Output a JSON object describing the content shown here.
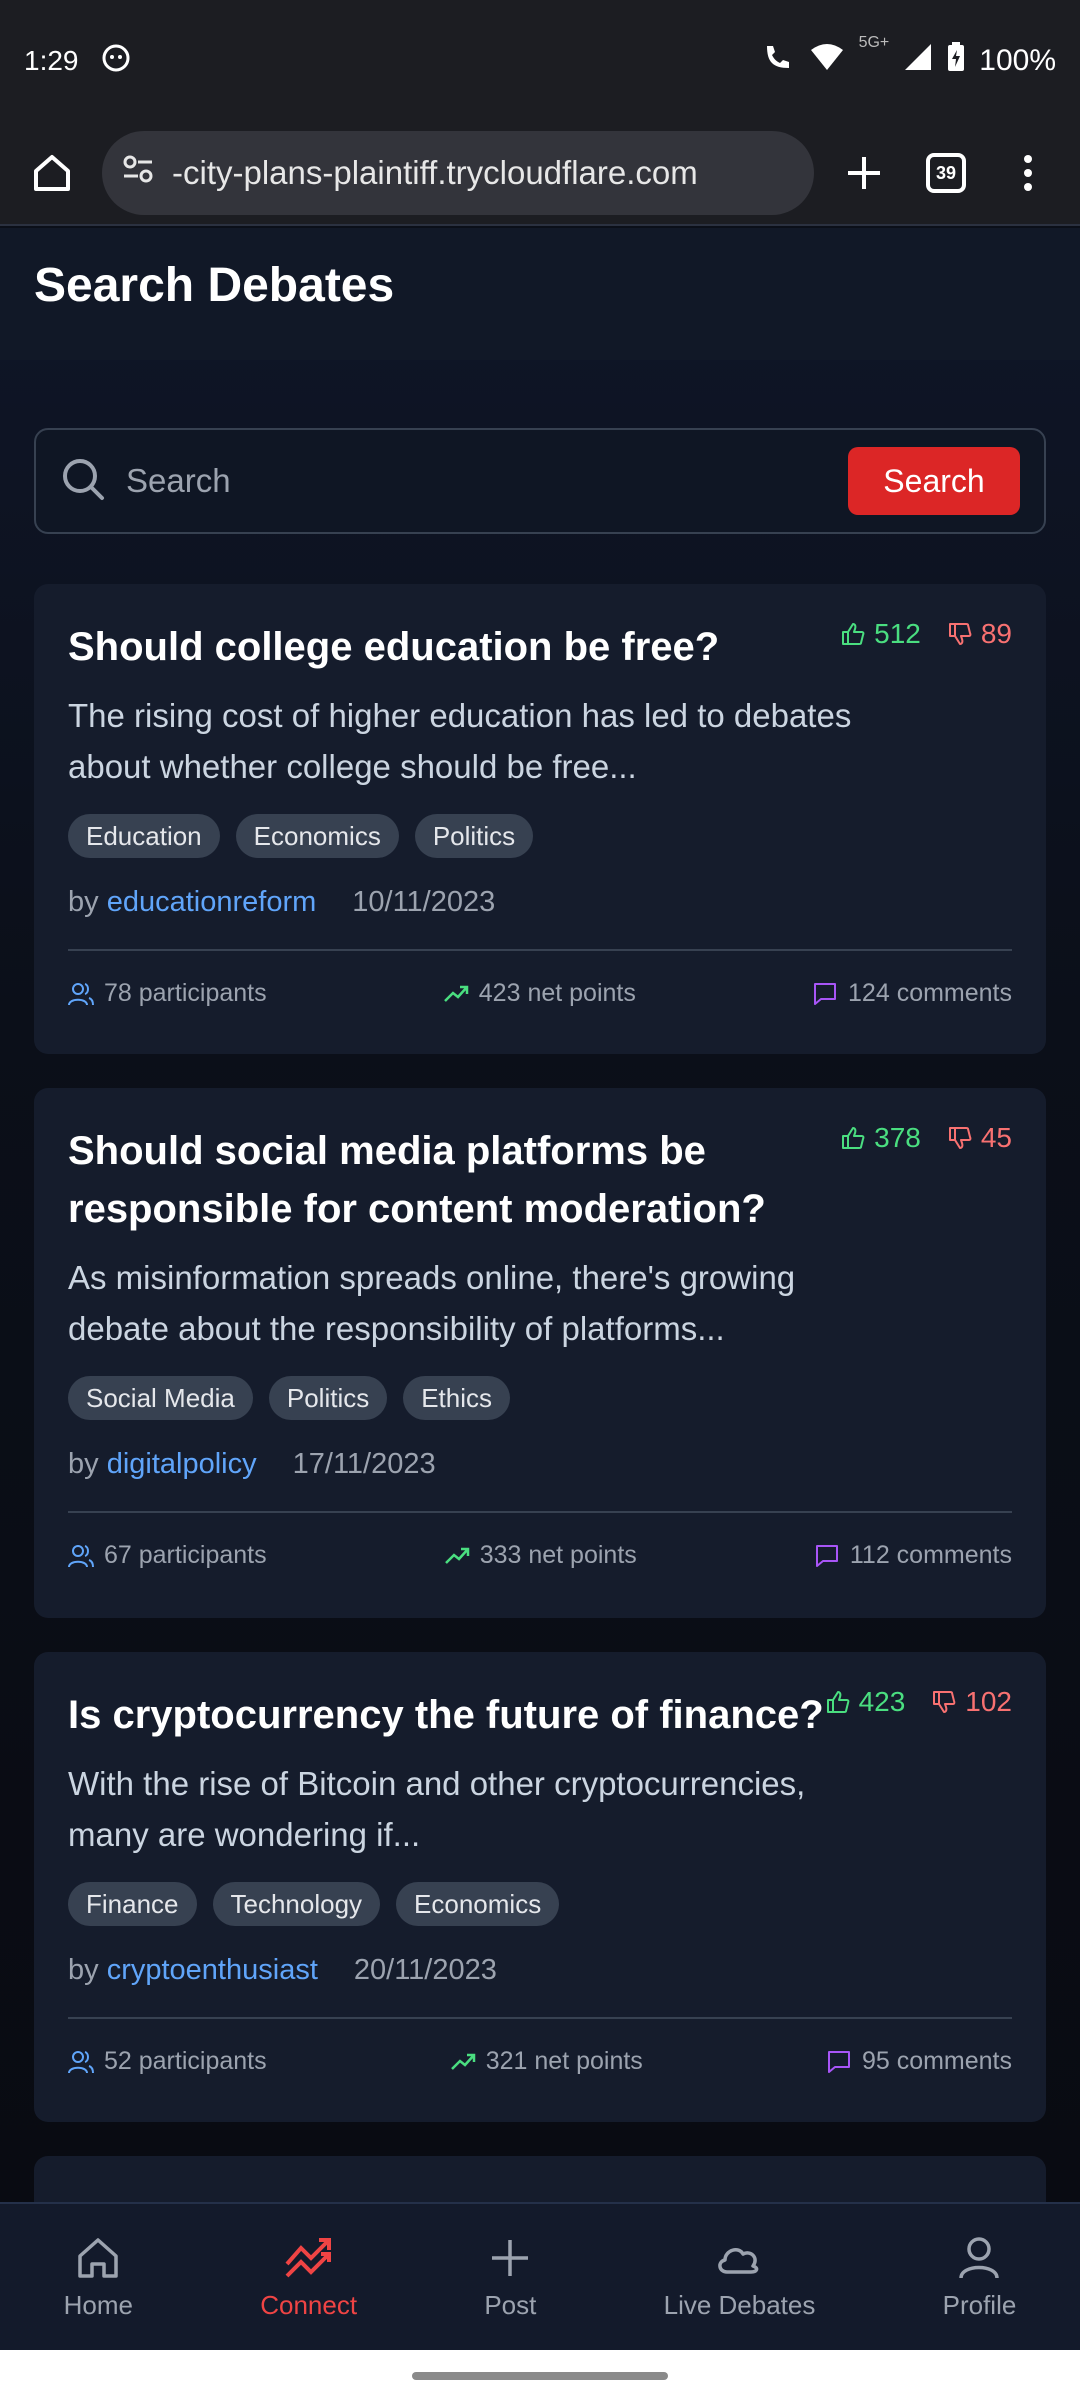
{
  "status_bar": {
    "time": "1:29",
    "battery": "100%",
    "network": "5G+"
  },
  "browser": {
    "url": "-city-plans-plaintiff.trycloudflare.com",
    "tab_count": "39"
  },
  "page": {
    "title": "Search Debates"
  },
  "search": {
    "placeholder": "Search",
    "button_label": "Search"
  },
  "debates": [
    {
      "title": "Should college education be free?",
      "upvotes": "512",
      "downvotes": "89",
      "description": "The rising cost of higher education has led to debates about whether college should be free...",
      "tags": [
        "Education",
        "Economics",
        "Politics"
      ],
      "by": "by",
      "author": "educationreform",
      "date": "10/11/2023",
      "participants": "78 participants",
      "net_points": "423 net points",
      "comments": "124 comments"
    },
    {
      "title": "Should social media platforms be responsible for content moderation?",
      "upvotes": "378",
      "downvotes": "45",
      "description": "As misinformation spreads online, there's growing debate about the responsibility of platforms...",
      "tags": [
        "Social Media",
        "Politics",
        "Ethics"
      ],
      "by": "by",
      "author": "digitalpolicy",
      "date": "17/11/2023",
      "participants": "67 participants",
      "net_points": "333 net points",
      "comments": "112 comments"
    },
    {
      "title": "Is cryptocurrency the future of finance?",
      "upvotes": "423",
      "downvotes": "102",
      "description": "With the rise of Bitcoin and other cryptocurrencies, many are wondering if...",
      "tags": [
        "Finance",
        "Technology",
        "Economics"
      ],
      "by": "by",
      "author": "cryptoenthusiast",
      "date": "20/11/2023",
      "participants": "52 participants",
      "net_points": "321 net points",
      "comments": "95 comments"
    }
  ],
  "nav": [
    {
      "label": "Home",
      "icon": "home-icon"
    },
    {
      "label": "Connect",
      "icon": "trending-icon",
      "active": true
    },
    {
      "label": "Post",
      "icon": "plus-icon"
    },
    {
      "label": "Live Debates",
      "icon": "cloud-icon"
    },
    {
      "label": "Profile",
      "icon": "user-icon"
    }
  ],
  "colors": {
    "accent": "#dc2626",
    "upvote": "#4ade80",
    "downvote": "#f87171",
    "link": "#60a5fa"
  }
}
